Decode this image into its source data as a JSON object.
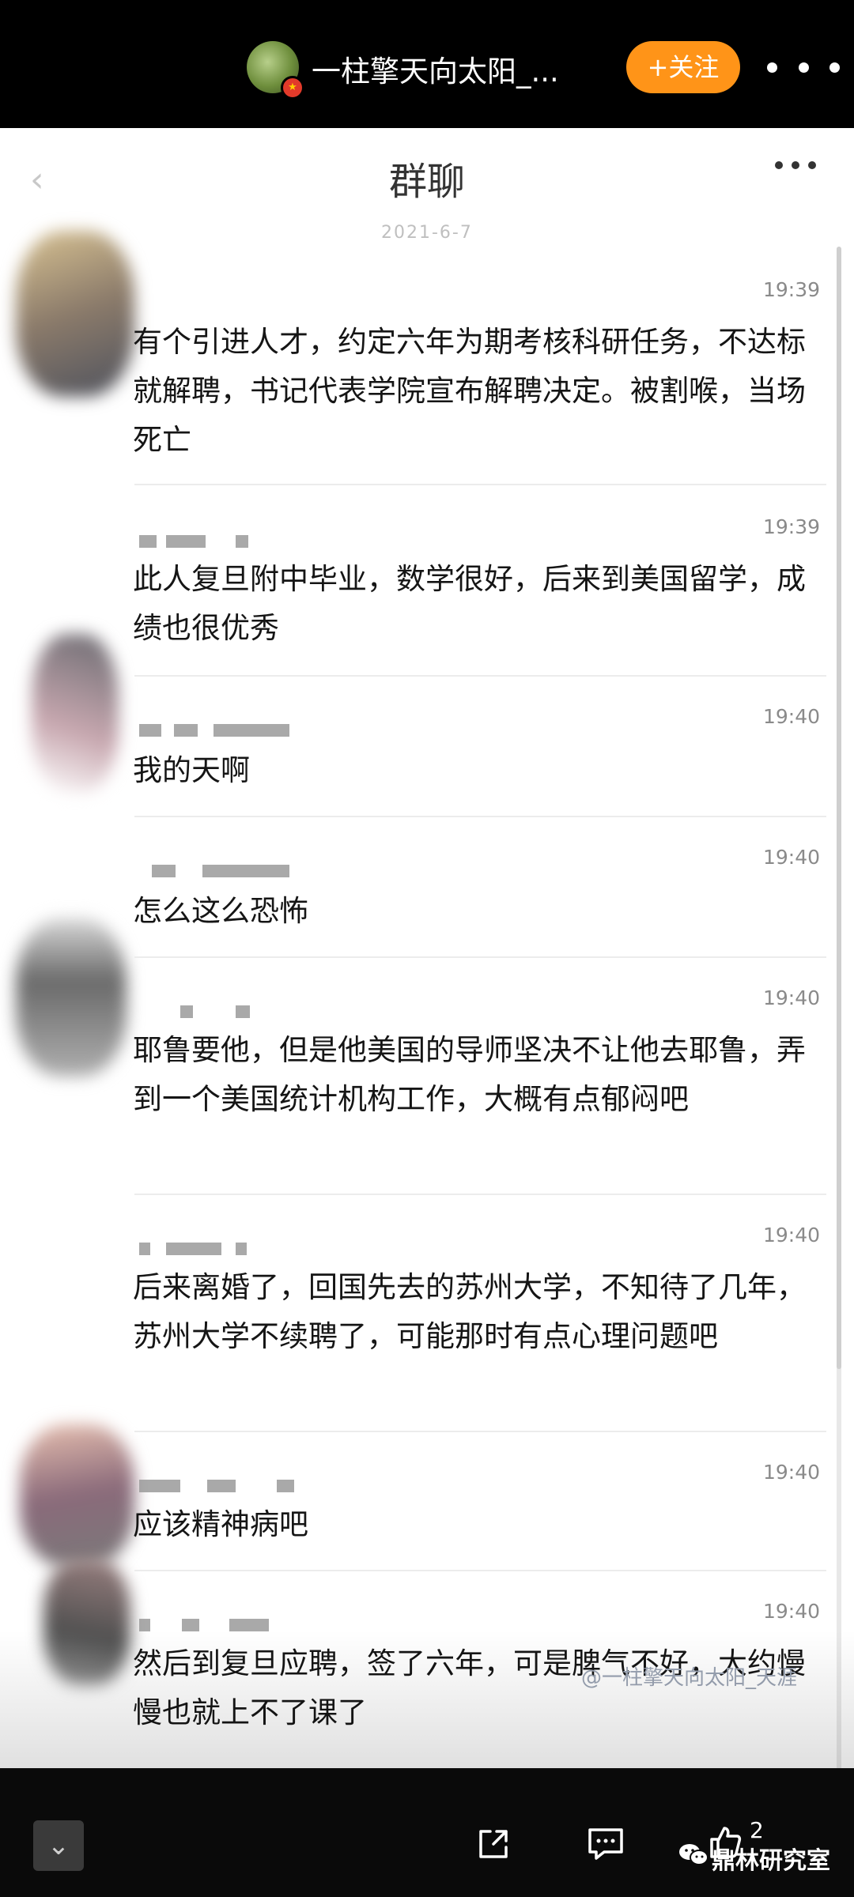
{
  "header": {
    "account_name": "一柱擎天向太阳_...",
    "follow_label": "+关注",
    "avatar_badge": "★"
  },
  "chat": {
    "back_glyph": "‹",
    "title": "群聊",
    "date": "2021-6-7",
    "messages": [
      {
        "time": "19:39",
        "text": "有个引进人才，约定六年为期考核科研任务，不达标就解聘，书记代表学院宣布解聘决定。被割喉，当场死亡"
      },
      {
        "time": "19:39",
        "text": "此人复旦附中毕业，数学很好，后来到美国留学，成绩也很优秀"
      },
      {
        "time": "19:40",
        "text": "我的天啊"
      },
      {
        "time": "19:40",
        "text": "怎么这么恐怖"
      },
      {
        "time": "19:40",
        "text": "耶鲁要他，但是他美国的导师坚决不让他去耶鲁，弄到一个美国统计机构工作，大概有点郁闷吧"
      },
      {
        "time": "19:40",
        "text": "后来离婚了，回国先去的苏州大学，不知待了几年，苏州大学不续聘了，可能那时有点心理问题吧"
      },
      {
        "time": "19:40",
        "text": "应该精神病吧"
      },
      {
        "time": "19:40",
        "text": "然后到复旦应聘，签了六年，可是脾气不好，大约慢慢也就上不了课了"
      }
    ],
    "watermark": "@一柱擎天向太阳_天涯"
  },
  "footer": {
    "collapse_glyph": "⌄",
    "like_count": "2",
    "brand": "鼎林研究室"
  },
  "colors": {
    "follow": "#ff9418",
    "top_bar": "#000000",
    "panel": "#ffffff"
  }
}
